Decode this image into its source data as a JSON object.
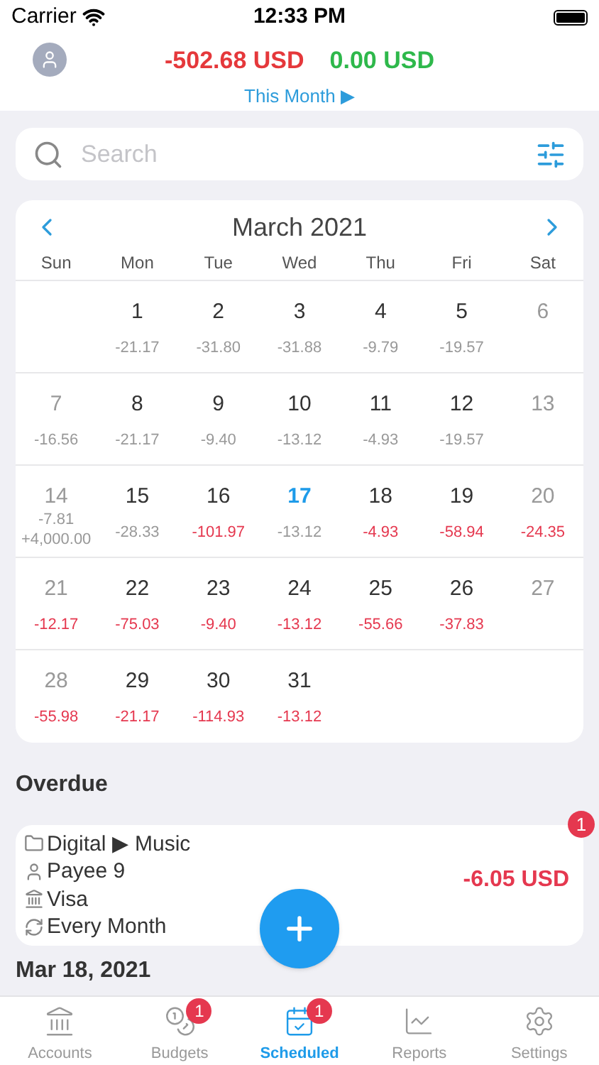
{
  "status_bar": {
    "carrier": "Carrier",
    "time": "12:33 PM"
  },
  "header": {
    "expense": "-502.68 USD",
    "income": "0.00 USD",
    "period": "This Month ▶"
  },
  "search": {
    "placeholder": "Search"
  },
  "calendar": {
    "title": "March 2021",
    "weekdays": [
      "Sun",
      "Mon",
      "Tue",
      "Wed",
      "Thu",
      "Fri",
      "Sat"
    ],
    "weeks": [
      [
        {
          "kind": "empty"
        },
        {
          "kind": "day",
          "day": "1",
          "weekend": false,
          "today": false,
          "amounts": [
            {
              "text": "-21.17",
              "upcoming": false
            }
          ]
        },
        {
          "kind": "day",
          "day": "2",
          "weekend": false,
          "today": false,
          "amounts": [
            {
              "text": "-31.80",
              "upcoming": false
            }
          ]
        },
        {
          "kind": "day",
          "day": "3",
          "weekend": false,
          "today": false,
          "amounts": [
            {
              "text": "-31.88",
              "upcoming": false
            }
          ]
        },
        {
          "kind": "day",
          "day": "4",
          "weekend": false,
          "today": false,
          "amounts": [
            {
              "text": "-9.79",
              "upcoming": false
            }
          ]
        },
        {
          "kind": "day",
          "day": "5",
          "weekend": false,
          "today": false,
          "amounts": [
            {
              "text": "-19.57",
              "upcoming": false
            }
          ]
        },
        {
          "kind": "day",
          "day": "6",
          "weekend": true,
          "today": false
        }
      ],
      [
        {
          "kind": "day",
          "day": "7",
          "weekend": true,
          "today": false,
          "amounts": [
            {
              "text": "-16.56",
              "upcoming": false
            }
          ]
        },
        {
          "kind": "day",
          "day": "8",
          "weekend": false,
          "today": false,
          "amounts": [
            {
              "text": "-21.17",
              "upcoming": false
            }
          ]
        },
        {
          "kind": "day",
          "day": "9",
          "weekend": false,
          "today": false,
          "amounts": [
            {
              "text": "-9.40",
              "upcoming": false
            }
          ]
        },
        {
          "kind": "day",
          "day": "10",
          "weekend": false,
          "today": false,
          "amounts": [
            {
              "text": "-13.12",
              "upcoming": false
            }
          ]
        },
        {
          "kind": "day",
          "day": "11",
          "weekend": false,
          "today": false,
          "amounts": [
            {
              "text": "-4.93",
              "upcoming": false
            }
          ]
        },
        {
          "kind": "day",
          "day": "12",
          "weekend": false,
          "today": false,
          "amounts": [
            {
              "text": "-19.57",
              "upcoming": false
            }
          ]
        },
        {
          "kind": "day",
          "day": "13",
          "weekend": true,
          "today": false
        }
      ],
      [
        {
          "kind": "day",
          "day": "14",
          "weekend": true,
          "today": false,
          "amounts": [
            {
              "text": "-7.81",
              "upcoming": false
            },
            {
              "text": "+4,000.00",
              "upcoming": false
            }
          ]
        },
        {
          "kind": "day",
          "day": "15",
          "weekend": false,
          "today": false,
          "amounts": [
            {
              "text": "-28.33",
              "upcoming": false
            }
          ]
        },
        {
          "kind": "day",
          "day": "16",
          "weekend": false,
          "today": false,
          "amounts": [
            {
              "text": "-101.97",
              "upcoming": true
            }
          ]
        },
        {
          "kind": "day",
          "day": "17",
          "weekend": false,
          "today": true,
          "amounts": [
            {
              "text": "-13.12",
              "upcoming": false
            }
          ]
        },
        {
          "kind": "day",
          "day": "18",
          "weekend": false,
          "today": false,
          "amounts": [
            {
              "text": "-4.93",
              "upcoming": true
            }
          ]
        },
        {
          "kind": "day",
          "day": "19",
          "weekend": false,
          "today": false,
          "amounts": [
            {
              "text": "-58.94",
              "upcoming": true
            }
          ]
        },
        {
          "kind": "day",
          "day": "20",
          "weekend": true,
          "today": false,
          "amounts": [
            {
              "text": "-24.35",
              "upcoming": true
            }
          ]
        }
      ],
      [
        {
          "kind": "day",
          "day": "21",
          "weekend": true,
          "today": false,
          "amounts": [
            {
              "text": "-12.17",
              "upcoming": true
            }
          ]
        },
        {
          "kind": "day",
          "day": "22",
          "weekend": false,
          "today": false,
          "amounts": [
            {
              "text": "-75.03",
              "upcoming": true
            }
          ]
        },
        {
          "kind": "day",
          "day": "23",
          "weekend": false,
          "today": false,
          "amounts": [
            {
              "text": "-9.40",
              "upcoming": true
            }
          ]
        },
        {
          "kind": "day",
          "day": "24",
          "weekend": false,
          "today": false,
          "amounts": [
            {
              "text": "-13.12",
              "upcoming": true
            }
          ]
        },
        {
          "kind": "day",
          "day": "25",
          "weekend": false,
          "today": false,
          "amounts": [
            {
              "text": "-55.66",
              "upcoming": true
            }
          ]
        },
        {
          "kind": "day",
          "day": "26",
          "weekend": false,
          "today": false,
          "amounts": [
            {
              "text": "-37.83",
              "upcoming": true
            }
          ]
        },
        {
          "kind": "day",
          "day": "27",
          "weekend": true,
          "today": false
        }
      ],
      [
        {
          "kind": "day",
          "day": "28",
          "weekend": true,
          "today": false,
          "amounts": [
            {
              "text": "-55.98",
              "upcoming": true
            }
          ]
        },
        {
          "kind": "day",
          "day": "29",
          "weekend": false,
          "today": false,
          "amounts": [
            {
              "text": "-21.17",
              "upcoming": true
            }
          ]
        },
        {
          "kind": "day",
          "day": "30",
          "weekend": false,
          "today": false,
          "amounts": [
            {
              "text": "-114.93",
              "upcoming": true
            }
          ]
        },
        {
          "kind": "day",
          "day": "31",
          "weekend": false,
          "today": false,
          "amounts": [
            {
              "text": "-13.12",
              "upcoming": true
            }
          ]
        },
        {
          "kind": "empty"
        },
        {
          "kind": "empty"
        },
        {
          "kind": "empty"
        }
      ]
    ]
  },
  "overdue": {
    "title": "Overdue",
    "items": [
      {
        "category": "Digital ▶ Music",
        "payee": "Payee 9",
        "account": "Visa",
        "repeat": "Every Month",
        "amount": "-6.05 USD",
        "badge": "1"
      }
    ]
  },
  "next_section": {
    "title": "Mar 18, 2021"
  },
  "tabs": [
    {
      "label": "Accounts",
      "selected": false
    },
    {
      "label": "Budgets",
      "selected": false,
      "badge": "1"
    },
    {
      "label": "Scheduled",
      "selected": true,
      "badge": "1"
    },
    {
      "label": "Reports",
      "selected": false
    },
    {
      "label": "Settings",
      "selected": false
    }
  ]
}
